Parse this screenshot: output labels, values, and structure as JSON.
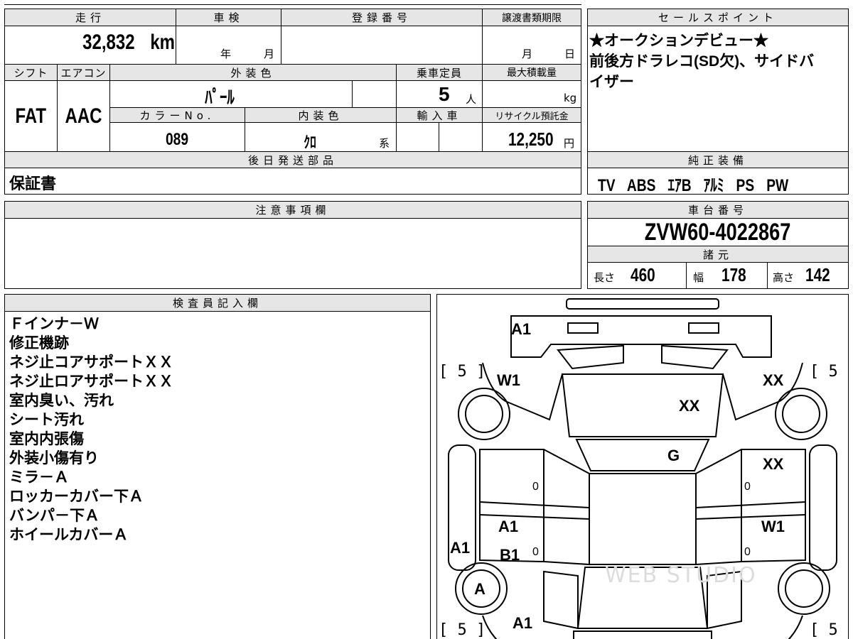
{
  "vehicle_info": {
    "mileage_label": "走行",
    "mileage_value": "32,832",
    "mileage_unit": "km",
    "shaken_label": "車検",
    "shaken_year_unit": "年",
    "shaken_month_unit": "月",
    "registration_label": "登録番号",
    "transfer_deadline_label": "譲渡書類期限",
    "transfer_month_unit": "月",
    "transfer_day_unit": "日",
    "shift_label": "シフト",
    "shift_value": "FAT",
    "aircon_label": "エアコン",
    "aircon_value": "AAC",
    "exterior_color_label": "外装色",
    "exterior_color_value": "ﾊﾟｰﾙ",
    "capacity_label": "乗車定員",
    "capacity_value": "5",
    "capacity_unit": "人",
    "max_load_label": "最大積載量",
    "max_load_unit": "kg",
    "color_no_label": "カラーNo.",
    "color_no_value": "089",
    "interior_color_label": "内装色",
    "interior_color_value": "ｸﾛ",
    "interior_color_suffix": "系",
    "import_label": "輸入車",
    "recycle_label": "リサイクル預託金",
    "recycle_value": "12,250",
    "recycle_unit": "円",
    "later_parts_label": "後日発送部品",
    "later_parts_value": "保証書"
  },
  "sales_point": {
    "label": "セールスポイント",
    "lines": [
      "★オークションデビュー★",
      "前後方ドラレコ(SD欠)、サイドバ",
      "イザー"
    ]
  },
  "genuine_equipment": {
    "label": "純正装備",
    "items": [
      "TV",
      "ABS",
      "ｴｱB",
      "ｱﾙﾐ",
      "PS",
      "PW"
    ]
  },
  "caution": {
    "label": "注意事項欄"
  },
  "chassis": {
    "label": "車台番号",
    "value": "ZVW60-4022867"
  },
  "specs": {
    "label": "諸元",
    "length_label": "長さ",
    "length_value": "460",
    "width_label": "幅",
    "width_value": "178",
    "height_label": "高さ",
    "height_value": "142"
  },
  "inspector": {
    "label": "検査員記入欄",
    "notes": [
      "Ｆインナ－Ｗ",
      "修正機跡",
      "ネジ止コアサポートＸＸ",
      "ネジ止ロアサポートＸＸ",
      "室内臭い、汚れ",
      "シート汚れ",
      "室内内張傷",
      "外装小傷有り",
      "ミラ－Ａ",
      "ロッカーカバー下Ａ",
      "バンパ－下Ａ",
      "ホイールカバーＡ"
    ]
  },
  "diagram": {
    "front_bumper": "A1",
    "bonnet": "XX",
    "left_front_fender": "W1",
    "right_front_fender": "XX",
    "roof": "G",
    "right_front_door": "XX",
    "left_rear_door_1": "A1",
    "left_rear_door_2": "B1",
    "left_rocker": "A1",
    "right_rear_door": "W1",
    "left_rear_wheel": "A",
    "rear_bumper": "A1",
    "tire_tread": "5",
    "door_zero": "0",
    "watermark": "WEB STUDIO"
  }
}
